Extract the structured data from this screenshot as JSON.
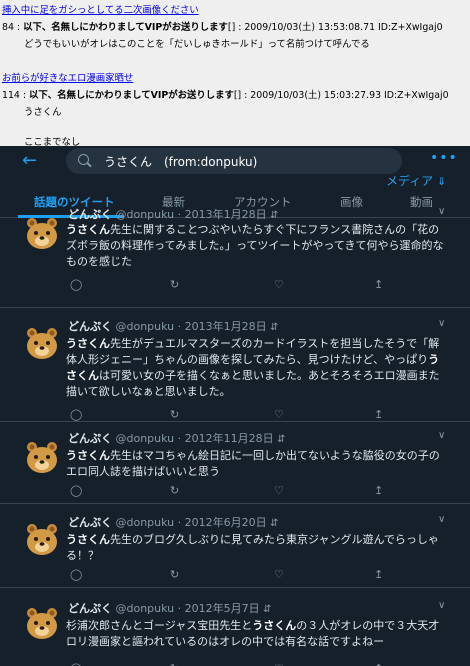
{
  "forum": {
    "top_link": "挿入中に足をガシっとしてる二次画像ください",
    "posts": [
      {
        "num": "84",
        "sep": " : ",
        "name": "以下、名無しにかわりましてVIPがお送りします",
        "meta": "[] : 2009/10/03(土) 13:53:08.71 ID:Z+XwIgaj0",
        "lines": [
          "どうでもいいがオレはこのことを「だいしゅきホールド」って名前つけて呼んでる"
        ]
      },
      {
        "num": "114",
        "sep": " : ",
        "name": "以下、名無しにかわりましてVIPがお送りします",
        "meta": "[] : 2009/10/03(土) 15:03:27.93 ID:Z+XwIgaj0",
        "lines": [
          "うさくん",
          "",
          "ここまでなし"
        ]
      }
    ],
    "mid_link": "お前らが好きなエロ漫画家晒せ"
  },
  "twitter": {
    "search_query": "うさくん　(from:donpuku)",
    "media_label": "メディア",
    "tabs": [
      "話題のツイート",
      "最新",
      "アカウント",
      "画像",
      "動画"
    ],
    "tweets": [
      {
        "name": "どんぷく",
        "handle": "@donpuku",
        "date": "· 2013年1月28日",
        "text_html": "<b>うさくん</b>先生に関することつぶやいたらすぐ下にフランス書院さんの「花のズボラ飯の料理作ってみました。」ってツイートがやってきて何やら運命的なものを感じた"
      },
      {
        "name": "どんぷく",
        "handle": "@donpuku",
        "date": "· 2013年1月28日",
        "text_html": "<b>うさくん</b>先生がデュエルマスターズのカードイラストを担当したそうで「解体人形ジェニー」ちゃんの画像を探してみたら、見つけたけど、やっぱり<b>うさくん</b>は可愛い女の子を描くなぁと思いました。あとそろそろエロ漫画また描いて欲しいなぁと思いました。"
      },
      {
        "name": "どんぷく",
        "handle": "@donpuku",
        "date": "· 2012年11月28日",
        "text_html": "<b>うさくん</b>先生はマコちゃん絵日記に一回しか出てないような脇役の女の子のエロ同人誌を描けばいいと思う"
      },
      {
        "name": "どんぷく",
        "handle": "@donpuku",
        "date": "· 2012年6月20日",
        "text_html": "<b>うさくん</b>先生のブログ久しぶりに見てみたら東京ジャングル遊んでらっしゃる！？"
      },
      {
        "name": "どんぷく",
        "handle": "@donpuku",
        "date": "· 2012年5月7日",
        "text_html": "杉浦次郎さんとゴージャス宝田先生と<b>うさくん</b>の３人がオレの中で３大天才ロリ漫画家と謳われているのはオレの中では有名な話ですよねー"
      }
    ],
    "icons": {
      "reply": "reply-icon",
      "retweet": "retweet-icon",
      "like": "like-icon",
      "share": "share-icon"
    },
    "colors": {
      "background": "#15202b",
      "accent": "#1da1f2",
      "text": "#e1e8ed",
      "muted": "#8899a6"
    }
  }
}
